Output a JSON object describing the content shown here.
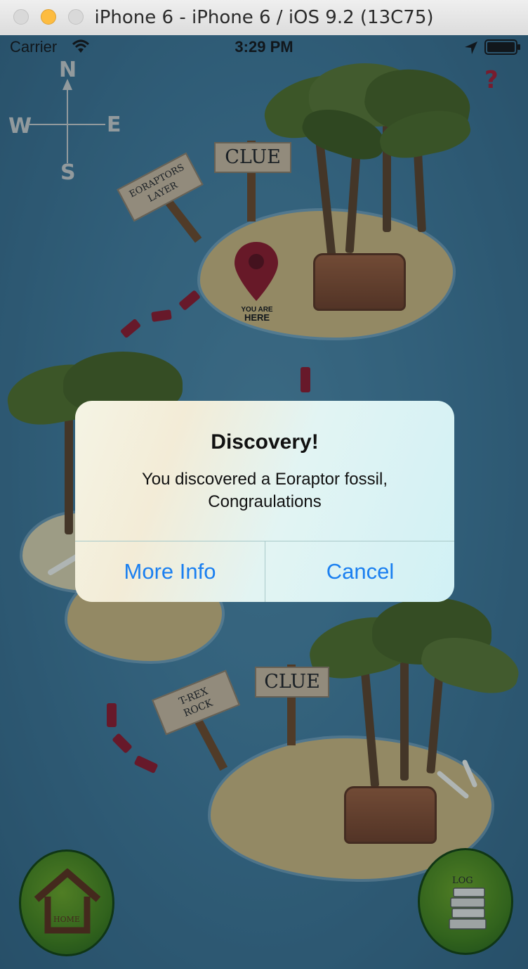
{
  "window": {
    "title": "iPhone 6 - iPhone 6 / iOS 9.2 (13C75)",
    "traffic_lights": {
      "close": "#fc5753",
      "minimize": "#fdbc40",
      "zoom": "#34c84a"
    }
  },
  "status_bar": {
    "carrier": "Carrier",
    "time": "3:29 PM",
    "icons": [
      "wifi-icon",
      "location-arrow-icon",
      "battery-icon"
    ]
  },
  "map": {
    "compass": {
      "north": "N",
      "south": "S",
      "east": "E",
      "west": "W"
    },
    "help_label": "?",
    "top_island": {
      "clue_sign": "CLUE",
      "name_sign_line1": "EORAPTORS",
      "name_sign_line2": "LAYER",
      "marker_line1": "YOU ARE",
      "marker_line2": "HERE"
    },
    "bottom_island": {
      "clue_sign": "CLUE",
      "name_sign_line1": "T-REX",
      "name_sign_line2": "ROCK"
    },
    "home_button_label": "HOME",
    "log_button_label": "LOG",
    "colors": {
      "ocean": "#3f7897",
      "sand": "#cbb478",
      "path": "#8c1424",
      "palm": "#4e6b22",
      "button": "#3f7d12"
    }
  },
  "alert": {
    "title": "Discovery!",
    "message_line1": "You discovered a Eoraptor fossil,",
    "message_line2": "Congraulations",
    "more_info_label": "More Info",
    "cancel_label": "Cancel",
    "button_color": "#1a7ff0"
  }
}
